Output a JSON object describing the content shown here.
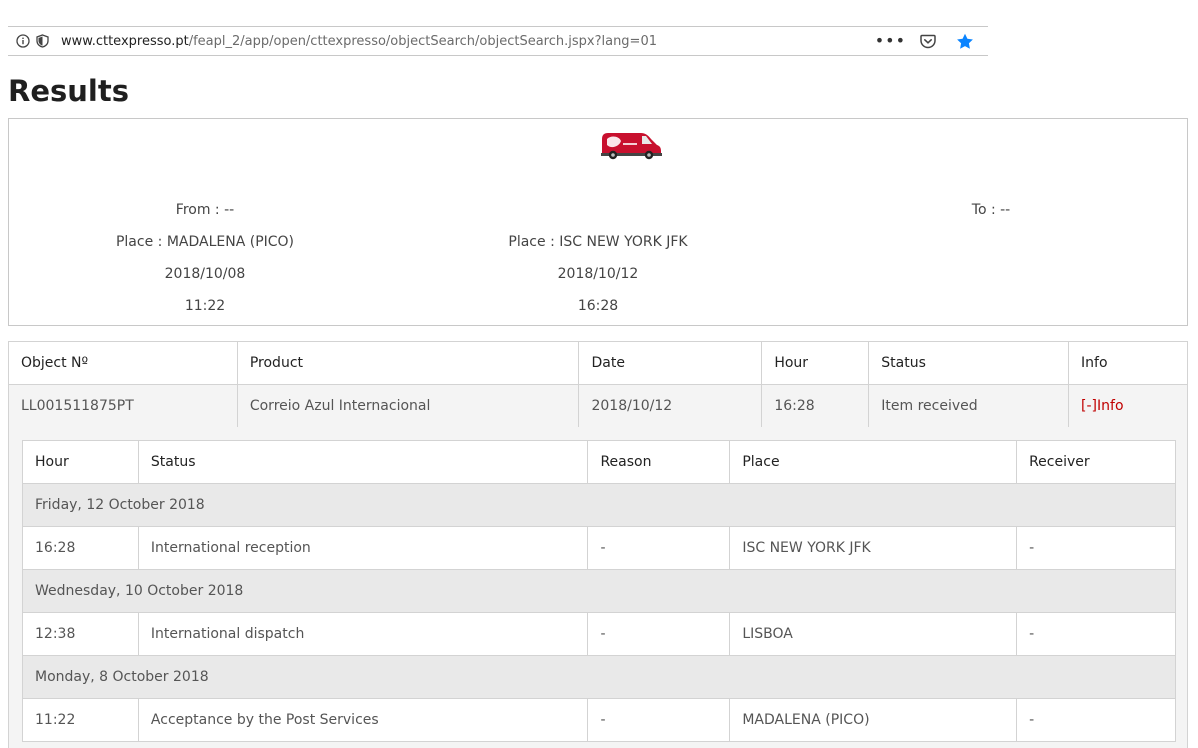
{
  "browser": {
    "url_host": "www.cttexpresso.pt",
    "url_path": "/feapl_2/app/open/cttexpresso/objectSearch/objectSearch.jspx?lang=01"
  },
  "page": {
    "title": "Results"
  },
  "summary": {
    "from": "From : --",
    "to": "To : --",
    "origin_place": "Place : MADALENA (PICO)",
    "origin_date": "2018/10/08",
    "origin_time": "11:22",
    "dest_place": "Place : ISC NEW YORK JFK",
    "dest_date": "2018/10/12",
    "dest_time": "16:28"
  },
  "objects": {
    "headers": [
      "Object Nº",
      "Product",
      "Date",
      "Hour",
      "Status",
      "Info"
    ],
    "row": {
      "object": "LL001511875PT",
      "product": "Correio Azul Internacional",
      "date": "2018/10/12",
      "hour": "16:28",
      "status": "Item received",
      "info": "[-]Info"
    }
  },
  "events": {
    "headers": [
      "Hour",
      "Status",
      "Reason",
      "Place",
      "Receiver"
    ],
    "days": [
      {
        "label": "Friday, 12 October 2018",
        "hour": "16:28",
        "status": "International reception",
        "reason": "-",
        "place": "ISC NEW YORK JFK",
        "receiver": "-"
      },
      {
        "label": "Wednesday, 10 October 2018",
        "hour": "12:38",
        "status": "International dispatch",
        "reason": "-",
        "place": "LISBOA",
        "receiver": "-"
      },
      {
        "label": "Monday, 8 October 2018",
        "hour": "11:22",
        "status": "Acceptance by the Post Services",
        "reason": "-",
        "place": "MADALENA (PICO)",
        "receiver": "-"
      }
    ]
  },
  "colors": {
    "accent_red": "#c00000",
    "star_blue": "#0a84ff",
    "van_red": "#c8102e"
  },
  "icons": [
    "info-icon",
    "shield-icon",
    "more-icon",
    "pocket-icon",
    "bookmark-star-icon",
    "delivery-van-icon"
  ]
}
